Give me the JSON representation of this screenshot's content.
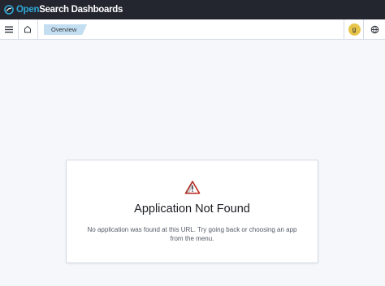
{
  "brand": {
    "prefix": "Open",
    "name": "Search Dashboards"
  },
  "navbar": {
    "breadcrumb": "Overview",
    "user_initial": "g"
  },
  "error": {
    "title": "Application Not Found",
    "message": "No application was found at this URL. Try going back or choosing an app from the menu."
  },
  "icons": {
    "menu": "hamburger-menu-icon",
    "home": "home-icon",
    "help": "help-globe-icon",
    "alert": "warning-icon"
  },
  "colors": {
    "topbar": "#23262f",
    "brand_accent": "#2ea7d6",
    "breadcrumb_bg": "#c3def0",
    "avatar_bg": "#e7c54a",
    "warning_red": "#bd271e"
  }
}
